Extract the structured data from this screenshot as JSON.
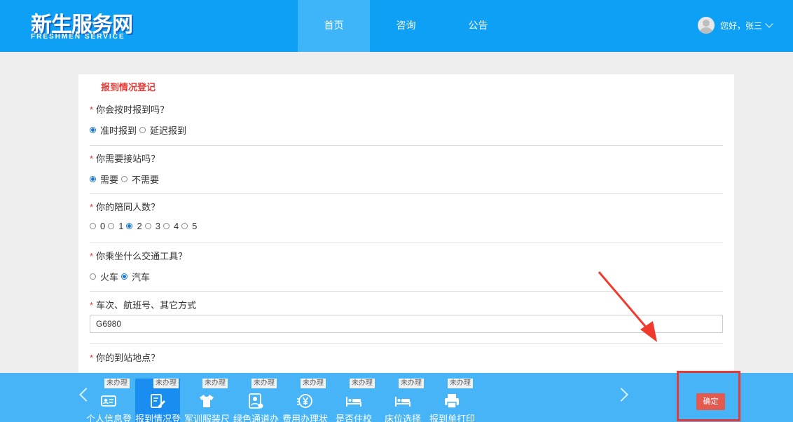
{
  "header": {
    "logo_text": "新生服务网",
    "logo_sub": "FRESHMEN SERVICE",
    "nav": [
      "首页",
      "咨询",
      "公告"
    ],
    "active_nav": "首页",
    "greeting": "您好，张三"
  },
  "form": {
    "title": "报到情况登记",
    "required_mark": "*",
    "q1": {
      "label": "你会按时报到吗？",
      "options": [
        "准时报到",
        "延迟报到"
      ],
      "selected": "准时报到"
    },
    "q2": {
      "label": "你需要接站吗？",
      "options": [
        "需要",
        "不需要"
      ],
      "selected": "需要"
    },
    "q3": {
      "label": "你的陪同人数？",
      "options": [
        "0",
        "1",
        "2",
        "3",
        "4",
        "5"
      ],
      "selected": "2"
    },
    "q4": {
      "label": "你乘坐什么交通工具？",
      "options": [
        "火车",
        "汽车"
      ],
      "selected": "汽车"
    },
    "q5": {
      "label": "车次、航班号、其它方式",
      "value": "G6980"
    },
    "q6": {
      "label": "你的到站地点？"
    }
  },
  "bottom": {
    "tabs": [
      {
        "label": "个人信息登",
        "badge": "未办理",
        "icon": "id-card-icon"
      },
      {
        "label": "报到情况登",
        "badge": "未办理",
        "icon": "edit-form-icon"
      },
      {
        "label": "军训服装尺",
        "badge": "未办理",
        "icon": "tshirt-icon"
      },
      {
        "label": "绿色通道办",
        "badge": "未办理",
        "icon": "badge-user-icon"
      },
      {
        "label": "费用办理状",
        "badge": "未办理",
        "icon": "yuan-icon"
      },
      {
        "label": "是否住校",
        "badge": "未办理",
        "icon": "bed-icon"
      },
      {
        "label": "床位选择",
        "badge": "未办理",
        "icon": "bed-icon"
      },
      {
        "label": "报到单打印",
        "badge": "未办理",
        "icon": "printer-icon"
      }
    ],
    "active_tab": "报到情况登",
    "confirm_label": "确定"
  },
  "colors": {
    "header_bg": "#0ea0f4",
    "bottom_bg": "#47b4f7",
    "accent_red": "#e53935",
    "radio_on": "#1976d2"
  }
}
